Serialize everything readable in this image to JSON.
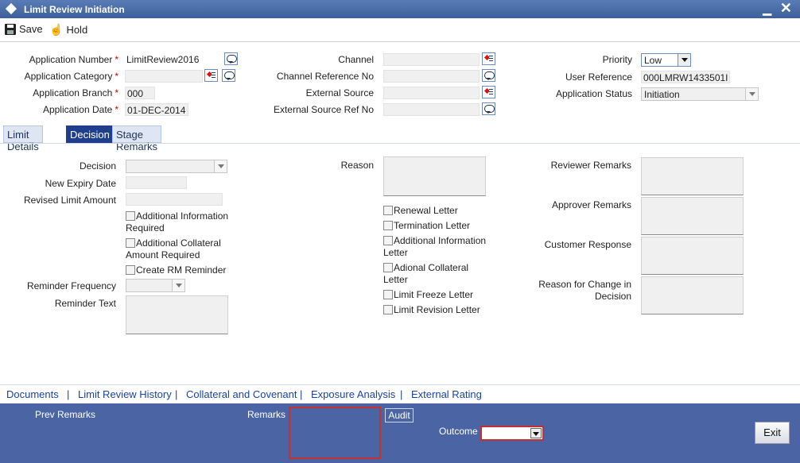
{
  "window": {
    "title": "Limit Review Initiation",
    "minimize": "▁",
    "close": "✕"
  },
  "toolbar": {
    "save_label": "Save",
    "hold_label": "Hold"
  },
  "header": {
    "application_number_label": "Application Number",
    "application_number_value": "LimitReview2016",
    "application_category_label": "Application Category",
    "application_category_value": "",
    "application_branch_label": "Application Branch",
    "application_branch_value": "000",
    "application_date_label": "Application Date",
    "application_date_value": "01-DEC-2014",
    "channel_label": "Channel",
    "channel_value": "",
    "channel_reference_label": "Channel Reference No",
    "channel_reference_value": "",
    "external_source_label": "External Source",
    "external_source_value": "",
    "external_source_ref_label": "External Source Ref No",
    "external_source_ref_value": "",
    "priority_label": "Priority",
    "priority_value": "Low",
    "user_reference_label": "User Reference",
    "user_reference_value": "000LMRW1433501I",
    "application_status_label": "Application Status",
    "application_status_value": "Initiation",
    "required_mark": "*"
  },
  "tabs": [
    {
      "label": "Limit Details",
      "active": false
    },
    {
      "label": "Decision",
      "active": true
    },
    {
      "label": "Stage Remarks",
      "active": false
    }
  ],
  "decision": {
    "decision_label": "Decision",
    "new_expiry_label": "New Expiry Date",
    "revised_limit_label": "Revised Limit Amount",
    "add_info_required_label": "Additional Information Required",
    "add_info_line1": "Additional Information",
    "add_info_line2": "Required",
    "add_collateral_line1": "Additional Collateral",
    "add_collateral_line2": "Amount Required",
    "create_rm_reminder_label": "Create RM Reminder",
    "reminder_frequency_label": "Reminder Frequency",
    "reminder_text_label": "Reminder Text",
    "reason_label": "Reason",
    "renewal_letter_label": "Renewal Letter",
    "termination_letter_label": "Termination Letter",
    "add_info_letter_line1": "Additional Information",
    "add_info_letter_line2": "Letter",
    "adional_collateral_line1": "Adional Collateral",
    "adional_collateral_line2": "Letter",
    "limit_freeze_letter_label": "Limit Freeze Letter",
    "limit_revision_letter_label": "Limit Revision Letter",
    "reviewer_remarks_label": "Reviewer Remarks",
    "approver_remarks_label": "Approver Remarks",
    "customer_response_label": "Customer Response",
    "reason_change_line1": "Reason for Change in",
    "reason_change_line2": "Decision"
  },
  "links": [
    "Documents",
    "Limit Review History",
    "Collateral and Covenant",
    "Exposure Analysis",
    "External Rating"
  ],
  "link_separator": "|",
  "footer": {
    "prev_remarks_label": "Prev Remarks",
    "remarks_label": "Remarks",
    "audit_label": "Audit",
    "outcome_label": "Outcome",
    "outcome_value": "",
    "exit_label": "Exit"
  }
}
